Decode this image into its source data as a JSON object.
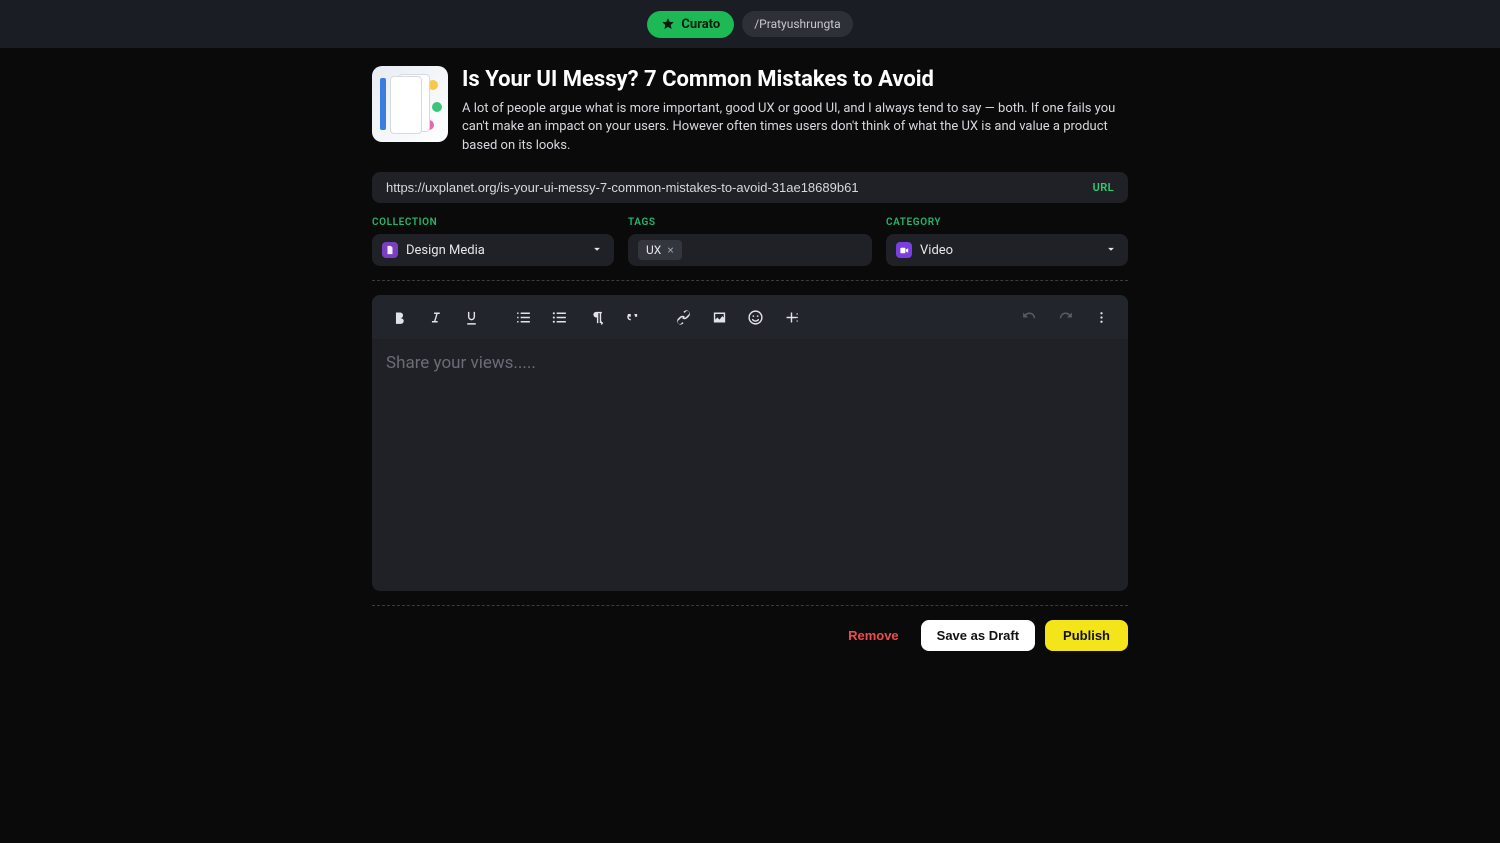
{
  "topbar": {
    "brand": "Curato",
    "user_path": "/Pratyushrungta"
  },
  "header": {
    "title": "Is Your UI Messy? 7 Common Mistakes to Avoid",
    "description": "A lot of people argue what is more important, good UX or good UI, and I always tend to say — both. If one fails you can't make an impact on your users. However often times users don't think of what the UX is and value a product based on its looks."
  },
  "url_field": {
    "value": "https://uxplanet.org/is-your-ui-messy-7-common-mistakes-to-avoid-31ae18689b61",
    "badge": "URL"
  },
  "selects": {
    "collection": {
      "label": "COLLECTION",
      "value": "Design Media"
    },
    "tags": {
      "label": "TAGS",
      "items": [
        "UX"
      ]
    },
    "category": {
      "label": "CATEGORY",
      "value": "Video"
    }
  },
  "editor": {
    "placeholder": "Share your views....."
  },
  "actions": {
    "remove": "Remove",
    "draft": "Save as Draft",
    "publish": "Publish"
  }
}
